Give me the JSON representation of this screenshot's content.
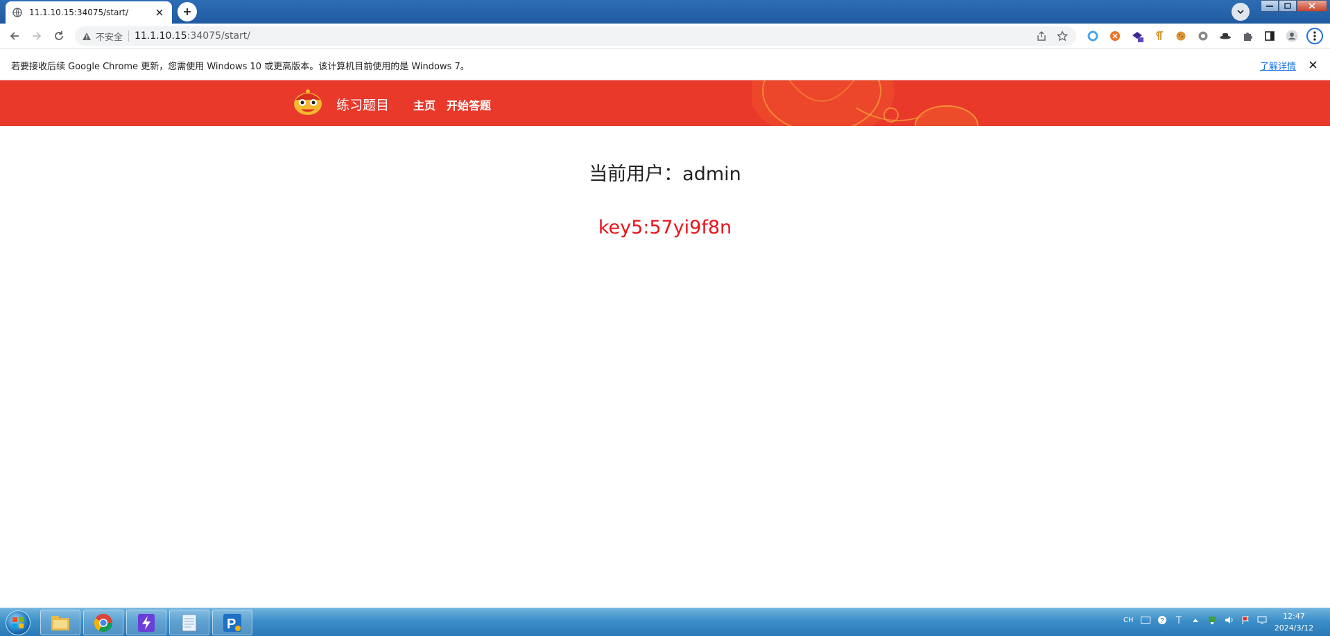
{
  "browser": {
    "tab_title": "11.1.10.15:34075/start/",
    "security_label": "不安全",
    "url_host": "11.1.10.15",
    "url_path": ":34075/start/"
  },
  "infobar": {
    "message": "若要接收后续 Google Chrome 更新，您需使用 Windows 10 或更高版本。该计算机目前使用的是 Windows 7。",
    "learn_more": "了解详情"
  },
  "site": {
    "brand": "练习题目",
    "nav": {
      "home": "主页",
      "start": "开始答题"
    },
    "header_color": "#e8392b"
  },
  "main": {
    "current_user": "当前用户：admin",
    "key": "key5:57yi9f8n",
    "key_color": "#e8141c"
  },
  "taskbar": {
    "apps": [
      "explorer-icon",
      "chrome-icon",
      "bolt-app-icon",
      "notepad-icon",
      "p-app-icon"
    ],
    "lang": "CH",
    "time": "12:47",
    "date": "2024/3/12"
  }
}
